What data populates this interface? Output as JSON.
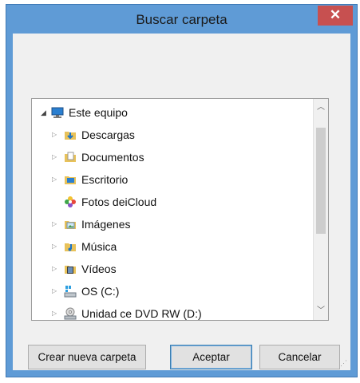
{
  "dialog": {
    "title": "Buscar carpeta",
    "close_label": "✕"
  },
  "tree": {
    "root": {
      "label": "Este equipo",
      "icon": "computer-icon"
    },
    "items": [
      {
        "label": "Descargas",
        "icon": "downloads-folder-icon",
        "expandable": true
      },
      {
        "label": "Documentos",
        "icon": "documents-folder-icon",
        "expandable": true
      },
      {
        "label": "Escritorio",
        "icon": "desktop-folder-icon",
        "expandable": true
      },
      {
        "label": "Fotos deiCloud",
        "icon": "icloud-photos-icon",
        "expandable": false
      },
      {
        "label": "Imágenes",
        "icon": "pictures-folder-icon",
        "expandable": true
      },
      {
        "label": "Música",
        "icon": "music-folder-icon",
        "expandable": true
      },
      {
        "label": "Vídeos",
        "icon": "videos-folder-icon",
        "expandable": true
      },
      {
        "label": "OS (C:)",
        "icon": "drive-icon",
        "expandable": true
      },
      {
        "label": "Unidad ce DVD RW (D:)",
        "icon": "dvd-drive-icon",
        "expandable": true
      }
    ]
  },
  "buttons": {
    "new_folder": "Crear nueva carpeta",
    "accept": "Aceptar",
    "cancel": "Cancelar"
  },
  "colors": {
    "frame": "#5f9bd6",
    "close": "#c75050",
    "client": "#f0f0f0"
  }
}
